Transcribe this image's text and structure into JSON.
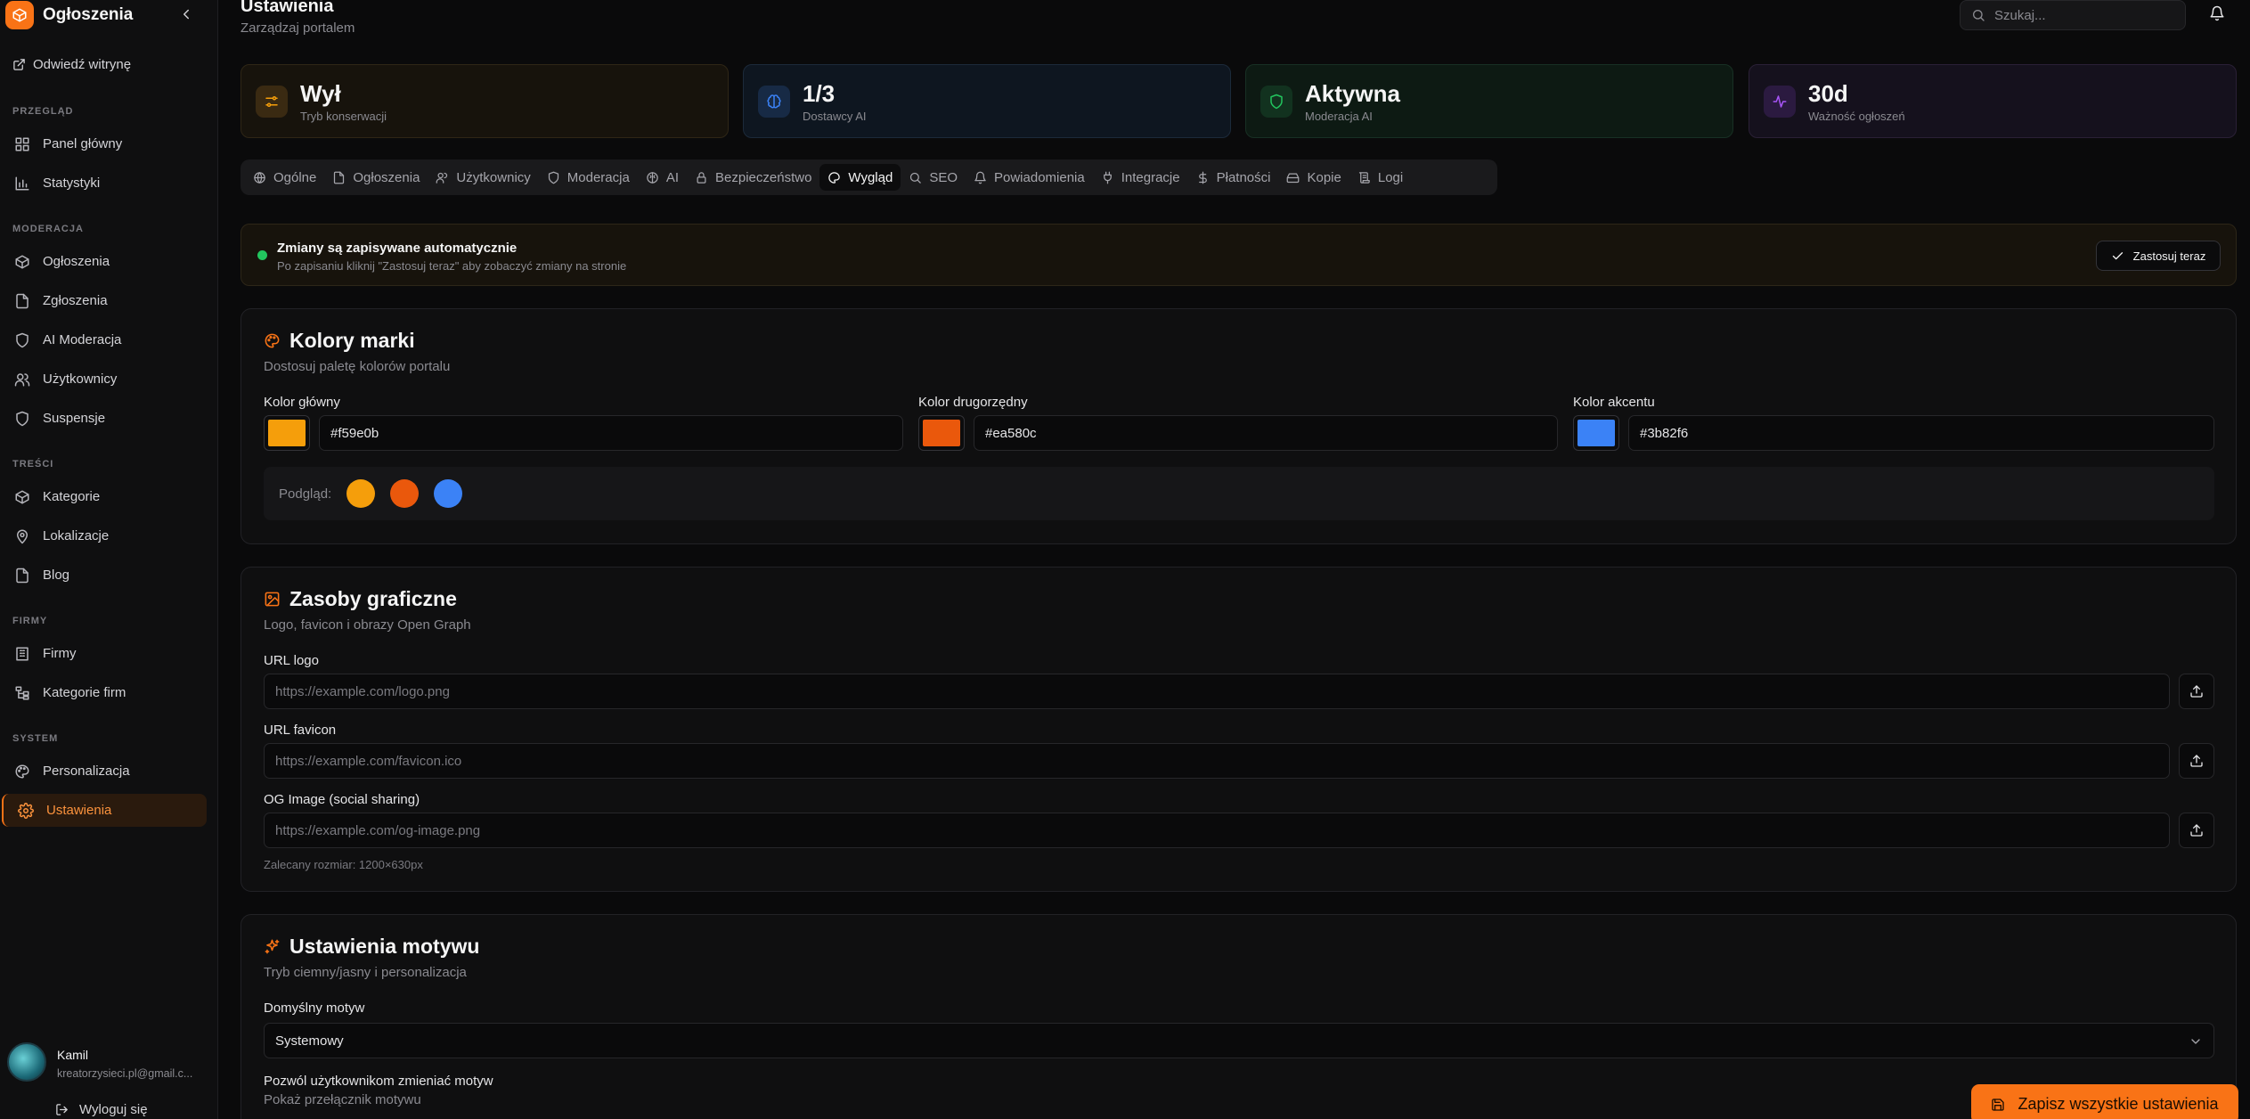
{
  "app": {
    "title": "Ogłoszenia",
    "visit_site": "Odwiedź witrynę"
  },
  "sidebar": {
    "sections": [
      {
        "label": "PRZEGLĄD"
      },
      {
        "label": "MODERACJA"
      },
      {
        "label": "TREŚCI"
      },
      {
        "label": "FIRMY"
      },
      {
        "label": "SYSTEM"
      }
    ],
    "items": [
      {
        "label": "Panel główny",
        "icon": "dashboard-icon"
      },
      {
        "label": "Statystyki",
        "icon": "chart-icon"
      },
      {
        "label": "Ogłoszenia",
        "icon": "package-icon"
      },
      {
        "label": "Zgłoszenia",
        "icon": "file-icon"
      },
      {
        "label": "AI Moderacja",
        "icon": "shield-icon"
      },
      {
        "label": "Użytkownicy",
        "icon": "users-icon"
      },
      {
        "label": "Suspensje",
        "icon": "shield-icon"
      },
      {
        "label": "Kategorie",
        "icon": "package-icon"
      },
      {
        "label": "Lokalizacje",
        "icon": "map-pin-icon"
      },
      {
        "label": "Blog",
        "icon": "file-icon"
      },
      {
        "label": "Firmy",
        "icon": "building-icon"
      },
      {
        "label": "Kategorie firm",
        "icon": "hierarchy-icon"
      },
      {
        "label": "Personalizacja",
        "icon": "palette-icon"
      },
      {
        "label": "Ustawienia",
        "icon": "gear-icon",
        "active": true
      }
    ],
    "user": {
      "name": "Kamil",
      "email": "kreatorzysieci.pl@gmail.c..."
    },
    "logout": "Wyloguj się"
  },
  "header": {
    "title": "Ustawienia",
    "subtitle": "Zarządzaj portalem",
    "search_placeholder": "Szukaj..."
  },
  "stats": [
    {
      "value": "Wył",
      "label": "Tryb konserwacji",
      "color": "#f59e0b"
    },
    {
      "value": "1/3",
      "label": "Dostawcy AI",
      "color": "#3b82f6"
    },
    {
      "value": "Aktywna",
      "label": "Moderacja AI",
      "color": "#22c55e"
    },
    {
      "value": "30d",
      "label": "Ważność ogłoszeń",
      "color": "#a855f7"
    }
  ],
  "tabs": [
    {
      "label": "Ogólne"
    },
    {
      "label": "Ogłoszenia"
    },
    {
      "label": "Użytkownicy"
    },
    {
      "label": "Moderacja"
    },
    {
      "label": "AI"
    },
    {
      "label": "Bezpieczeństwo"
    },
    {
      "label": "Wygląd",
      "active": true
    },
    {
      "label": "SEO"
    },
    {
      "label": "Powiadomienia"
    },
    {
      "label": "Integracje"
    },
    {
      "label": "Płatności"
    },
    {
      "label": "Kopie"
    },
    {
      "label": "Logi"
    }
  ],
  "banner": {
    "title": "Zmiany są zapisywane automatycznie",
    "subtitle": "Po zapisaniu kliknij \"Zastosuj teraz\" aby zobaczyć zmiany na stronie",
    "button": "Zastosuj teraz"
  },
  "brand_colors": {
    "title": "Kolory marki",
    "subtitle": "Dostosuj paletę kolorów portalu",
    "fields": [
      {
        "label": "Kolor główny",
        "value": "#f59e0b"
      },
      {
        "label": "Kolor drugorzędny",
        "value": "#ea580c"
      },
      {
        "label": "Kolor akcentu",
        "value": "#3b82f6"
      }
    ],
    "preview_label": "Podgląd:"
  },
  "assets": {
    "title": "Zasoby graficzne",
    "subtitle": "Logo, favicon i obrazy Open Graph",
    "fields": [
      {
        "label": "URL logo",
        "placeholder": "https://example.com/logo.png"
      },
      {
        "label": "URL favicon",
        "placeholder": "https://example.com/favicon.ico"
      },
      {
        "label": "OG Image (social sharing)",
        "placeholder": "https://example.com/og-image.png"
      }
    ],
    "hint": "Zalecany rozmiar: 1200×630px"
  },
  "theme": {
    "title": "Ustawienia motywu",
    "subtitle": "Tryb ciemny/jasny i personalizacja",
    "default_label": "Domyślny motyw",
    "default_value": "Systemowy",
    "allow_label": "Pozwól użytkownikom zmieniać motyw",
    "allow_sub": "Pokaż przełącznik motywu",
    "allow_enabled": true
  },
  "save_all": "Zapisz wszystkie ustawienia"
}
